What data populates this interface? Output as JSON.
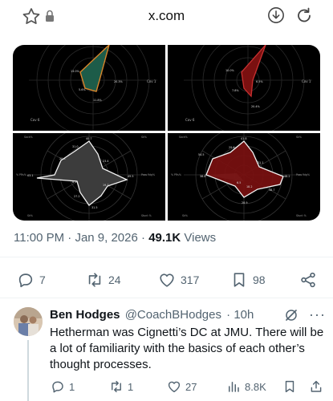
{
  "browser": {
    "domain": "x.com"
  },
  "charts": [
    {
      "top_right_label": "Cov 1",
      "bottom_left_label": "Cov 6",
      "point_labels": [
        "13.0%",
        "5.6%",
        "11.8%",
        "20.3%"
      ]
    },
    {
      "top_right_label": "Cov 1",
      "bottom_left_label": "Cov 6",
      "point_labels": [
        "10.0%",
        "7.8%",
        "6.5%",
        "20.4%"
      ]
    },
    {
      "axis_labels": [
        "Sack%",
        "Sk%",
        "Pass Ydg%",
        "Stunt %",
        "Sk%",
        "% PRs%"
      ],
      "value_labels": [
        "40.7",
        "31.0",
        "20.8",
        "23.4",
        "49.5",
        "19.7",
        "8.1",
        "27.2",
        "31.5",
        "63.1"
      ]
    },
    {
      "axis_labels": [
        "Sack%",
        "Sk%",
        "Pass Ydg%",
        "Stunt %",
        "Sk%",
        "% PRs%"
      ],
      "value_labels": [
        "41.8",
        "29.6",
        "54.5",
        "21.1",
        "48.2",
        "38.7",
        "18.2",
        "28.9",
        "6.5",
        "38.8"
      ]
    }
  ],
  "post": {
    "time": "11:00 PM",
    "sep": " · ",
    "date": "Jan 9, 2026",
    "views_count": "49.1K",
    "views_label": "Views"
  },
  "actions": {
    "replies": "7",
    "reposts": "24",
    "likes": "317",
    "bookmarks": "98"
  },
  "reply": {
    "name": "Ben Hodges",
    "handle": "@CoachBHodges",
    "time": "· 10h",
    "text": "Hetherman was Cignetti’s DC at JMU. There will be a lot of familiarity with the basics of each other’s thought processes.",
    "more": "···",
    "replies": "1",
    "reposts": "1",
    "likes": "27",
    "views": "8.8K"
  }
}
